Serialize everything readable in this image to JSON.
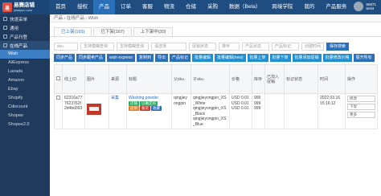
{
  "brand": {
    "name": "易赛店铺",
    "sub": "yisaiyun.com",
    "badge": "易"
  },
  "nav": [
    "首页",
    "授权",
    "产品",
    "订单",
    "客服",
    "物流",
    "仓储",
    "采购",
    "数据（Beta）",
    "跨境学院",
    "我的",
    "产品服务"
  ],
  "user": {
    "name": "66871",
    "role": "test4"
  },
  "sidebar": {
    "groups": [
      "快速采单",
      "通用",
      "产品刊登",
      "在线产品"
    ],
    "items": [
      "Wish",
      "AliExpress",
      "Lazada",
      "Amazon",
      "Ebay",
      "Shopify",
      "Cdiscount",
      "Shopee",
      "Shopee2.0"
    ]
  },
  "breadcrumb": "产品 › 在线产品 › Wish",
  "tabs": [
    "已上架(165)",
    "已下架(167)",
    "上下架中(30)"
  ],
  "filters": {
    "store": "sku",
    "placeholder": "支持模糊查询",
    "select_placeholder": "请选择",
    "status": "促销状态",
    "sort": "排序",
    "product_status": "产品状态",
    "tag": "产品标记",
    "created": "创建时间",
    "search": "保存搜索"
  },
  "actions": [
    "同步产品",
    "同步跟卖产品",
    "wish express",
    "复制到",
    "导出",
    "产品标记",
    "批量编辑",
    "批量编辑(new)",
    "批量上架",
    "批量下架",
    "批量添加促销",
    "批量修改价格",
    "展开所有",
    "批量"
  ],
  "table": {
    "headers": [
      "",
      "线上ID",
      "图片",
      "来源",
      "标题",
      "父sku",
      "子sku",
      "价格",
      "库存",
      "已加入促销",
      "标记状态",
      "时间",
      "操作"
    ],
    "row": {
      "id": "62316a777623762f2d4bd393",
      "title": "Washing powder",
      "tags": [
        "店铺",
        "已确定的",
        "促销",
        "备货",
        "收藏"
      ],
      "src": "采集",
      "parent_sku": "qingjieyongpin",
      "child_skus": [
        "qingjieyongpin_XS_White",
        "qingjieyongpin_XS_Black",
        "qingjieyongpin_XS_Blue"
      ],
      "prices": [
        "USD 0.01",
        "USD 0.01",
        "USD 0.01"
      ],
      "stock": [
        "999",
        "999",
        "999"
      ],
      "time": "2022.03.16 15:16:12",
      "ops": [
        "修改",
        "下架",
        "更多"
      ]
    }
  }
}
